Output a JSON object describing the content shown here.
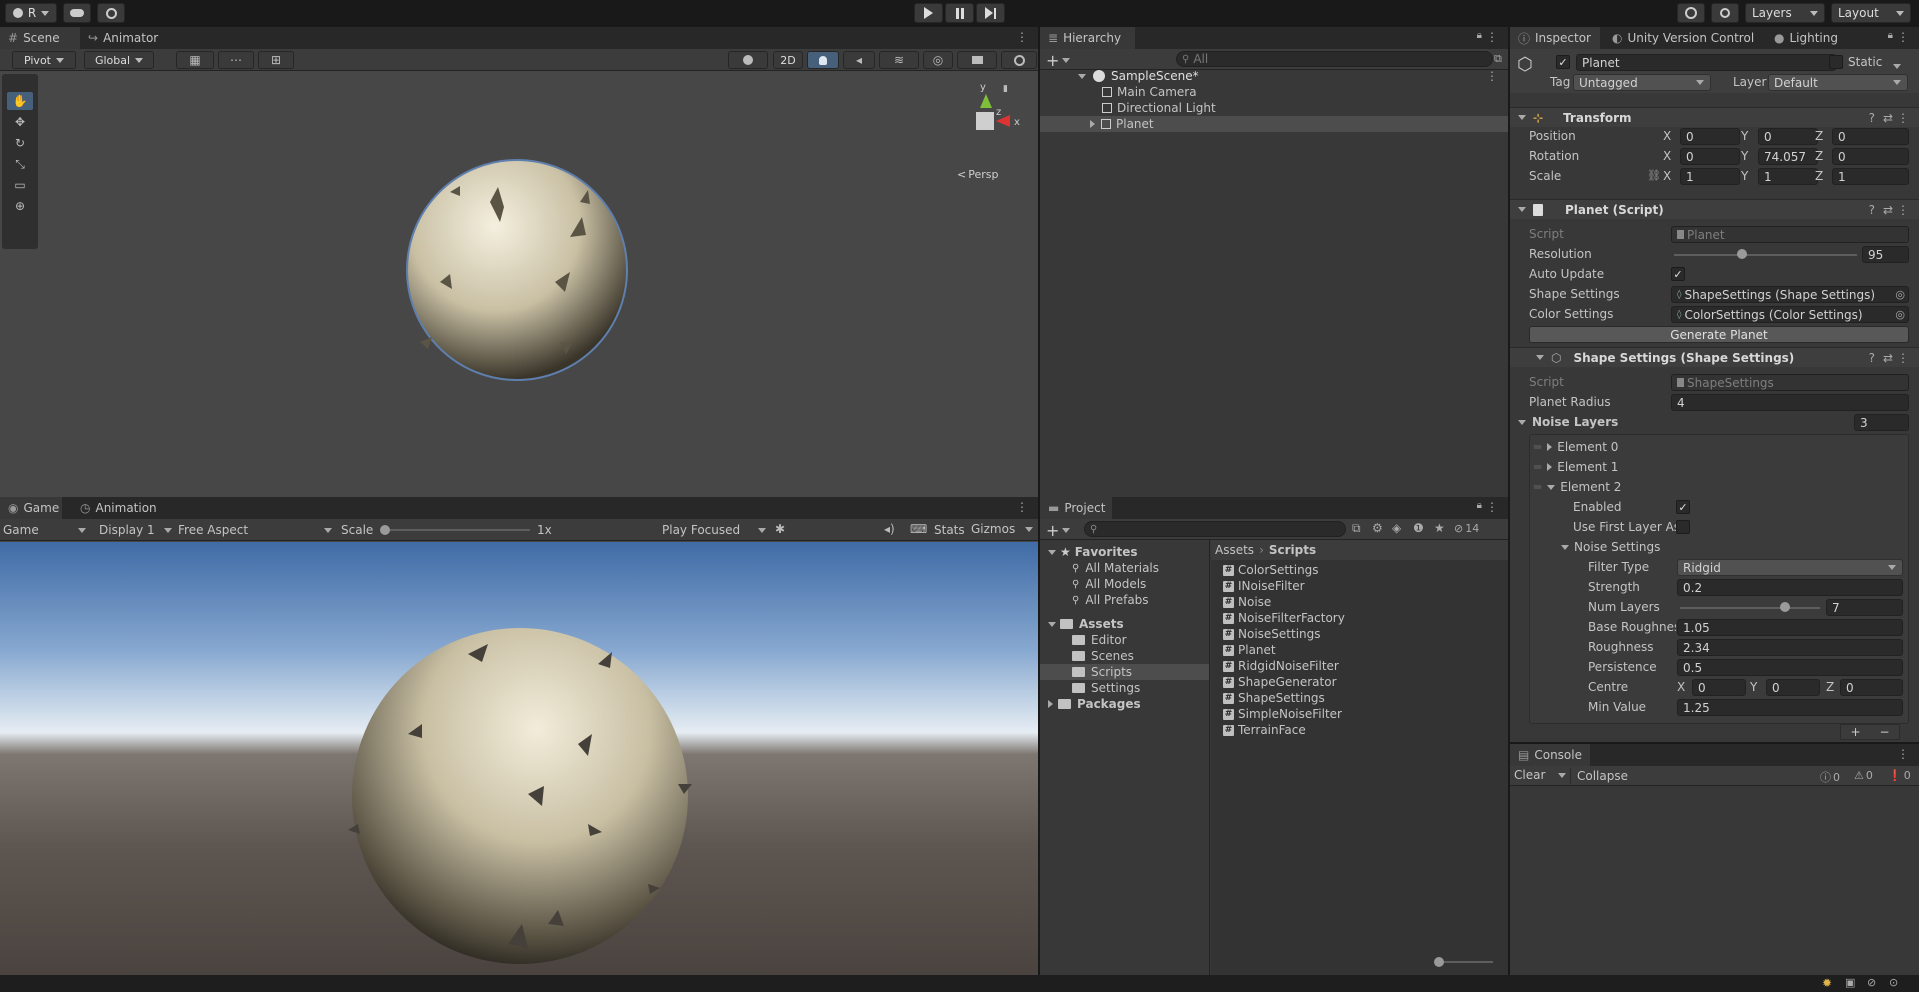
{
  "toolbar": {
    "account_label": "R",
    "layers_label": "Layers",
    "layout_label": "Layout"
  },
  "scene": {
    "tabs": [
      "Scene",
      "Animator"
    ],
    "pivot_label": "Pivot",
    "global_label": "Global",
    "btn_2d": "2D",
    "persp_label": "Persp",
    "gizmo_axes": [
      "y",
      "x",
      "z"
    ]
  },
  "game": {
    "tabs": [
      "Game",
      "Animation"
    ],
    "game_dropdown": "Game",
    "display_dropdown": "Display 1",
    "aspect_dropdown": "Free Aspect",
    "scale_label": "Scale",
    "scale_value": "1x",
    "scale_fraction": 0.0,
    "play_mode_dropdown": "Play Focused",
    "stats_label": "Stats",
    "gizmos_label": "Gizmos"
  },
  "hierarchy": {
    "tab": "Hierarchy",
    "search_placeholder": "All",
    "scene_name": "SampleScene*",
    "items": [
      "Main Camera",
      "Directional Light",
      "Planet"
    ]
  },
  "project": {
    "tab": "Project",
    "hidden_count": "14",
    "favorites_label": "Favorites",
    "favorites": [
      "All Materials",
      "All Models",
      "All Prefabs"
    ],
    "assets_label": "Assets",
    "asset_folders": [
      "Editor",
      "Scenes",
      "Scripts",
      "Settings"
    ],
    "packages_label": "Packages",
    "breadcrumb_root": "Assets",
    "breadcrumb_current": "Scripts",
    "files": [
      "ColorSettings",
      "INoiseFilter",
      "Noise",
      "NoiseFilterFactory",
      "NoiseSettings",
      "Planet",
      "RidgidNoiseFilter",
      "ShapeGenerator",
      "ShapeSettings",
      "SimpleNoiseFilter",
      "TerrainFace"
    ]
  },
  "inspector": {
    "tabs": [
      "Inspector",
      "Unity Version Control",
      "Lighting"
    ],
    "object_name": "Planet",
    "static_label": "Static",
    "tag_label": "Tag",
    "tag_value": "Untagged",
    "layer_label": "Layer",
    "layer_value": "Default",
    "transform": {
      "title": "Transform",
      "position_label": "Position",
      "rotation_label": "Rotation",
      "scale_label": "Scale",
      "position": [
        "0",
        "0",
        "0"
      ],
      "rotation": [
        "0",
        "74.057",
        "0"
      ],
      "scale": [
        "1",
        "1",
        "1"
      ],
      "axes": [
        "X",
        "Y",
        "Z"
      ]
    },
    "planet_script": {
      "title": "Planet (Script)",
      "script_label": "Script",
      "script_value": "Planet",
      "resolution_label": "Resolution",
      "resolution_value": "95",
      "resolution_fraction": 0.37,
      "auto_update_label": "Auto Update",
      "shape_settings_label": "Shape Settings",
      "shape_settings_value": "ShapeSettings (Shape Settings)",
      "color_settings_label": "Color Settings",
      "color_settings_value": "ColorSettings (Color Settings)",
      "generate_button": "Generate Planet"
    },
    "shape_settings": {
      "title": "Shape Settings (Shape Settings)",
      "script_label": "Script",
      "script_value": "ShapeSettings",
      "planet_radius_label": "Planet Radius",
      "planet_radius_value": "4",
      "noise_layers_label": "Noise Layers",
      "noise_layers_count": "3",
      "elements": [
        "Element 0",
        "Element 1",
        "Element 2"
      ],
      "enabled_label": "Enabled",
      "use_first_layer_label": "Use First Layer As",
      "noise_settings_label": "Noise Settings",
      "filter_type_label": "Filter Type",
      "filter_type_value": "Ridgid",
      "strength_label": "Strength",
      "strength_value": "0.2",
      "num_layers_label": "Num Layers",
      "num_layers_value": "7",
      "num_layers_fraction": 0.75,
      "base_roughness_label": "Base Roughnes",
      "base_roughness_value": "1.05",
      "roughness_label": "Roughness",
      "roughness_value": "2.34",
      "persistence_label": "Persistence",
      "persistence_value": "0.5",
      "centre_label": "Centre",
      "centre": [
        "0",
        "0",
        "0"
      ],
      "min_value_label": "Min Value",
      "min_value_value": "1.25"
    }
  },
  "console": {
    "tab": "Console",
    "clear_label": "Clear",
    "collapse_label": "Collapse",
    "log_count": "0",
    "warn_count": "0",
    "error_count": "0"
  }
}
